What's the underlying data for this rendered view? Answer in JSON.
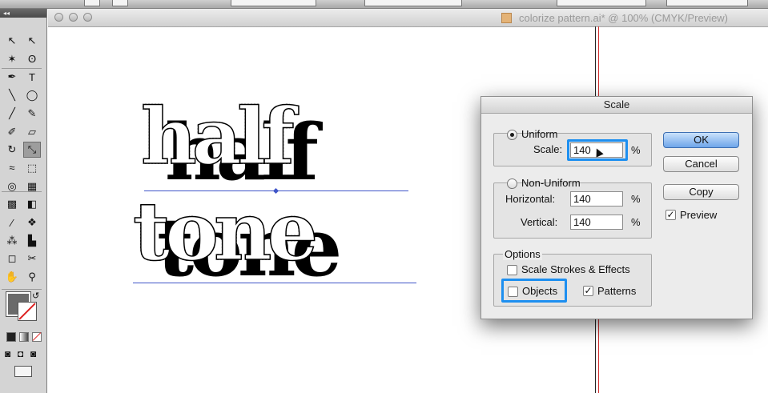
{
  "document": {
    "title": "colorize pattern.ai* @ 100% (CMYK/Preview)"
  },
  "artwork": {
    "line1": "half",
    "line2": "tone"
  },
  "tools": [
    {
      "name": "selection-tool",
      "glyph": "↖"
    },
    {
      "name": "direct-selection-tool",
      "glyph": "↖"
    },
    {
      "name": "magic-wand-tool",
      "glyph": "✶"
    },
    {
      "name": "lasso-tool",
      "glyph": "ʘ"
    },
    {
      "name": "pen-tool",
      "glyph": "✒"
    },
    {
      "name": "type-tool",
      "glyph": "T"
    },
    {
      "name": "line-tool",
      "glyph": "╲"
    },
    {
      "name": "ellipse-tool",
      "glyph": "◯"
    },
    {
      "name": "paintbrush-tool",
      "glyph": "╱"
    },
    {
      "name": "pencil-tool",
      "glyph": "✎"
    },
    {
      "name": "blob-brush-tool",
      "glyph": "✐"
    },
    {
      "name": "eraser-tool",
      "glyph": "▱"
    },
    {
      "name": "rotate-tool",
      "glyph": "↻"
    },
    {
      "name": "scale-tool",
      "glyph": "⤡"
    },
    {
      "name": "warp-tool",
      "glyph": "≈"
    },
    {
      "name": "free-transform-tool",
      "glyph": "⬚"
    },
    {
      "name": "shape-builder-tool",
      "glyph": "◎"
    },
    {
      "name": "perspective-grid-tool",
      "glyph": "▦"
    },
    {
      "name": "mesh-tool",
      "glyph": "▩"
    },
    {
      "name": "gradient-tool",
      "glyph": "◧"
    },
    {
      "name": "eyedropper-tool",
      "glyph": "⁄"
    },
    {
      "name": "blend-tool",
      "glyph": "❖"
    },
    {
      "name": "symbol-sprayer-tool",
      "glyph": "⁂"
    },
    {
      "name": "column-graph-tool",
      "glyph": "▙"
    },
    {
      "name": "artboard-tool",
      "glyph": "◻"
    },
    {
      "name": "slice-tool",
      "glyph": "✂"
    },
    {
      "name": "hand-tool",
      "glyph": "✋"
    },
    {
      "name": "zoom-tool",
      "glyph": "⚲"
    }
  ],
  "scale_dialog": {
    "title": "Scale",
    "uniform": {
      "label": "Uniform",
      "scale_label": "Scale:",
      "scale_value": "140",
      "unit": "%"
    },
    "non_uniform": {
      "label": "Non-Uniform",
      "horizontal_label": "Horizontal:",
      "horizontal_value": "140",
      "vertical_label": "Vertical:",
      "vertical_value": "140",
      "unit": "%"
    },
    "options": {
      "label": "Options",
      "scale_strokes_label": "Scale Strokes & Effects",
      "scale_strokes_checked": false,
      "objects_label": "Objects",
      "objects_checked": false,
      "patterns_label": "Patterns",
      "patterns_checked": true
    },
    "buttons": {
      "ok": "OK",
      "cancel": "Cancel",
      "copy": "Copy"
    },
    "preview_label": "Preview",
    "preview_checked": true,
    "highlight_color": "#1d8ff0"
  }
}
